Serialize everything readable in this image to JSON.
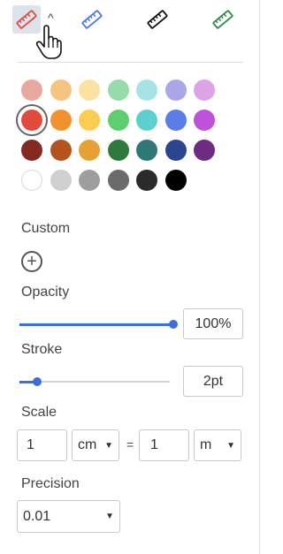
{
  "toolbar": {
    "tools": [
      {
        "icon": "ruler-icon",
        "color": "#e04a3f",
        "active": true
      },
      {
        "icon": "ruler-icon",
        "color": "#4a78e0",
        "active": false
      },
      {
        "icon": "ruler-icon",
        "color": "#111111",
        "active": false
      },
      {
        "icon": "ruler-icon",
        "color": "#2f8a4a",
        "active": false
      }
    ],
    "caret": "^"
  },
  "palette": {
    "rows": [
      [
        "#e8a89e",
        "#f5c57f",
        "#fbe2a0",
        "#97dbaa",
        "#a5e3e6",
        "#a8a8e6",
        "#dea2e6"
      ],
      [
        "#e24b3b",
        "#f2922f",
        "#fbcc50",
        "#5fce6e",
        "#5cd0d0",
        "#5a7ee6",
        "#bd52d8"
      ],
      [
        "#842a22",
        "#b4531e",
        "#e7a132",
        "#2e7a3c",
        "#2e7978",
        "#2b4592",
        "#6e2b82"
      ],
      [
        "#ffffff",
        "#cfcfcf",
        "#9e9e9e",
        "#6b6b6b",
        "#2b2b2b",
        "#000000"
      ]
    ],
    "selected": "#e24b3b"
  },
  "custom": {
    "label": "Custom",
    "add_icon": "plus-circle-icon"
  },
  "opacity": {
    "label": "Opacity",
    "value": "100%",
    "level": 1.0
  },
  "stroke": {
    "label": "Stroke",
    "value": "2pt",
    "level": 0.12
  },
  "scale": {
    "label": "Scale",
    "from_value": "1",
    "from_unit": "cm",
    "equals": "=",
    "to_value": "1",
    "to_unit": "m"
  },
  "precision": {
    "label": "Precision",
    "value": "0.01"
  }
}
